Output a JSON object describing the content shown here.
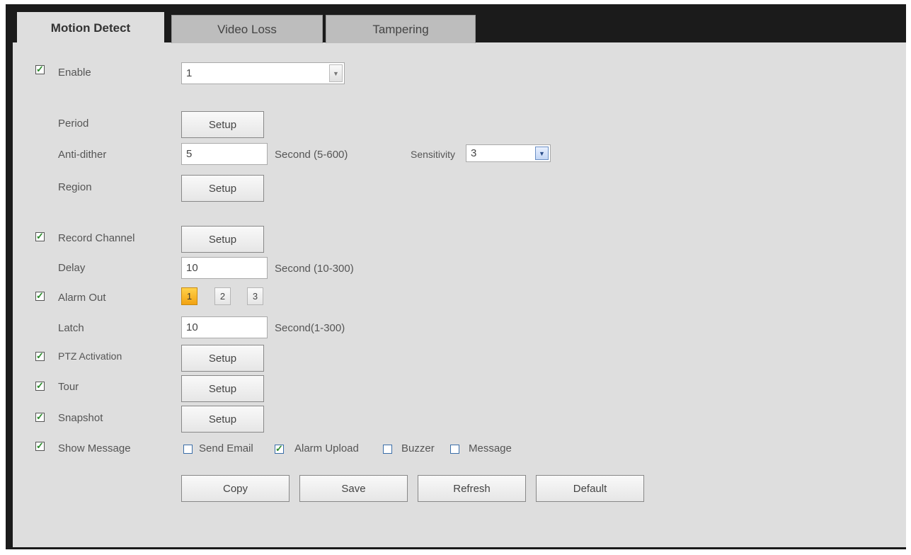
{
  "tabs": [
    "Motion Detect",
    "Video Loss",
    "Tampering"
  ],
  "enable": {
    "label": "Enable",
    "checked": true,
    "channel_value": "1"
  },
  "period": {
    "label": "Period",
    "button": "Setup"
  },
  "anti_dither": {
    "label": "Anti-dither",
    "value": "5",
    "unit": "Second (5-600)",
    "sensitivity_label": "Sensitivity",
    "sensitivity_value": "3"
  },
  "region": {
    "label": "Region",
    "button": "Setup"
  },
  "record_channel": {
    "label": "Record Channel",
    "checked": true,
    "button": "Setup"
  },
  "delay": {
    "label": "Delay",
    "value": "10",
    "unit": "Second (10-300)"
  },
  "alarm_out": {
    "label": "Alarm Out",
    "checked": true,
    "outputs": [
      "1",
      "2",
      "3"
    ],
    "active_output": "1"
  },
  "latch": {
    "label": "Latch",
    "value": "10",
    "unit": "Second(1-300)"
  },
  "ptz_activation": {
    "label": "PTZ Activation",
    "checked": true,
    "button": "Setup"
  },
  "tour": {
    "label": "Tour",
    "checked": true,
    "button": "Setup"
  },
  "snapshot": {
    "label": "Snapshot",
    "checked": true,
    "button": "Setup"
  },
  "show_message": {
    "label": "Show Message",
    "checked": true,
    "options": [
      {
        "label": "Send Email",
        "checked": false
      },
      {
        "label": "Alarm Upload",
        "checked": true
      },
      {
        "label": "Buzzer",
        "checked": false
      },
      {
        "label": "Message",
        "checked": false
      }
    ]
  },
  "actions": [
    "Copy",
    "Save",
    "Refresh",
    "Default"
  ]
}
